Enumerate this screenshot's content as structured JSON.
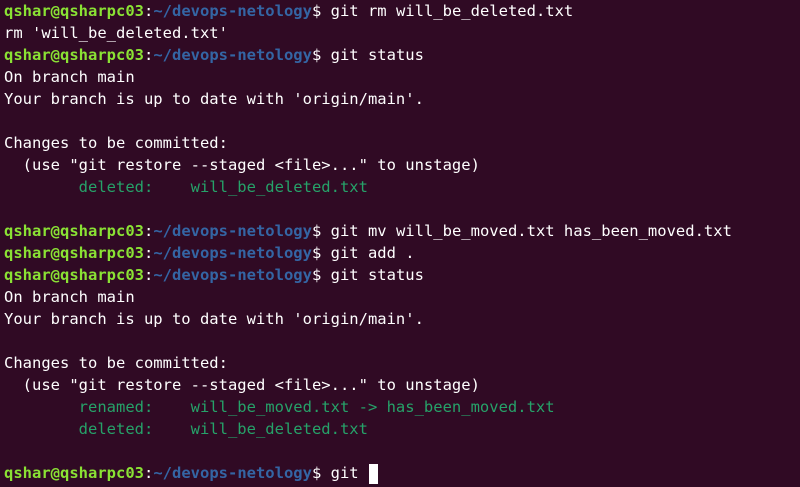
{
  "prompt": {
    "user_host": "qshar@qsharpc03",
    "colon": ":",
    "path": "~/devops-netology",
    "dollar": "$ "
  },
  "lines": [
    {
      "type": "prompt",
      "command": "git rm will_be_deleted.txt"
    },
    {
      "type": "output",
      "text": "rm 'will_be_deleted.txt'"
    },
    {
      "type": "prompt",
      "command": "git status"
    },
    {
      "type": "output",
      "text": "On branch main"
    },
    {
      "type": "output",
      "text": "Your branch is up to date with 'origin/main'."
    },
    {
      "type": "blank",
      "text": ""
    },
    {
      "type": "output",
      "text": "Changes to be committed:"
    },
    {
      "type": "output",
      "text": "  (use \"git restore --staged <file>...\" to unstage)"
    },
    {
      "type": "staged",
      "text": "\tdeleted:    will_be_deleted.txt"
    },
    {
      "type": "blank",
      "text": ""
    },
    {
      "type": "prompt",
      "command": "git mv will_be_moved.txt has_been_moved.txt"
    },
    {
      "type": "prompt",
      "command": "git add ."
    },
    {
      "type": "prompt",
      "command": "git status"
    },
    {
      "type": "output",
      "text": "On branch main"
    },
    {
      "type": "output",
      "text": "Your branch is up to date with 'origin/main'."
    },
    {
      "type": "blank",
      "text": ""
    },
    {
      "type": "output",
      "text": "Changes to be committed:"
    },
    {
      "type": "output",
      "text": "  (use \"git restore --staged <file>...\" to unstage)"
    },
    {
      "type": "staged",
      "text": "\trenamed:    will_be_moved.txt -> has_been_moved.txt"
    },
    {
      "type": "staged",
      "text": "\tdeleted:    will_be_deleted.txt"
    },
    {
      "type": "blank",
      "text": ""
    },
    {
      "type": "prompt",
      "command": "git ",
      "cursor": true
    }
  ],
  "colors": {
    "background": "#300a24",
    "user_host": "#8ae234",
    "path": "#3465a4",
    "staged": "#26a269",
    "text": "#ffffff"
  }
}
